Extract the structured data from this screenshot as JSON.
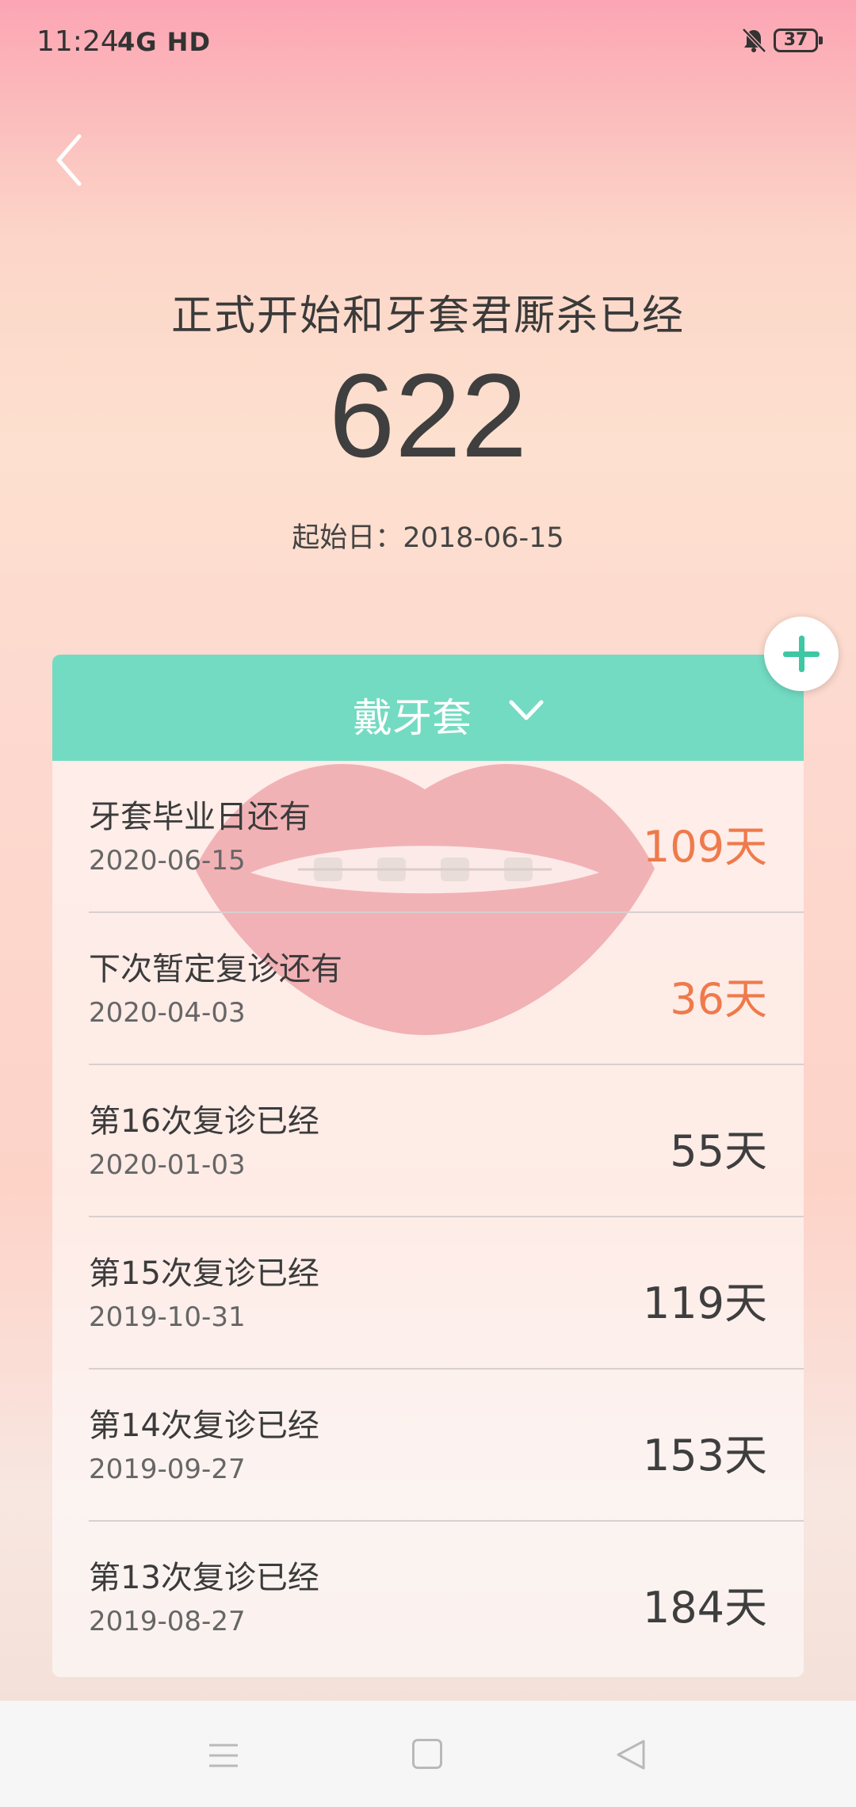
{
  "status_bar": {
    "time": "11:24",
    "network": "4G HD",
    "battery": "37"
  },
  "hero": {
    "title": "正式开始和牙套君厮杀已经",
    "count": "622",
    "start_label": "起始日：2018-06-15"
  },
  "card": {
    "header_label": "戴牙套",
    "items": [
      {
        "title": "牙套毕业日还有",
        "date": "2020-06-15",
        "days": "109天",
        "highlight": true
      },
      {
        "title": "下次暂定复诊还有",
        "date": "2020-04-03",
        "days": "36天",
        "highlight": true
      },
      {
        "title": "第16次复诊已经",
        "date": "2020-01-03",
        "days": "55天",
        "highlight": false
      },
      {
        "title": "第15次复诊已经",
        "date": "2019-10-31",
        "days": "119天",
        "highlight": false
      },
      {
        "title": "第14次复诊已经",
        "date": "2019-09-27",
        "days": "153天",
        "highlight": false
      },
      {
        "title": "第13次复诊已经",
        "date": "2019-08-27",
        "days": "184天",
        "highlight": false
      }
    ]
  },
  "colors": {
    "accent_green": "#73dbc2",
    "highlight_orange": "#ef7a4b",
    "plus_green": "#3ec7a2"
  },
  "icons": [
    "back-arrow-icon",
    "bell-muted-icon",
    "battery-icon",
    "plus-icon",
    "chevron-down-icon",
    "menu-icon",
    "home-icon",
    "back-triangle-icon"
  ]
}
